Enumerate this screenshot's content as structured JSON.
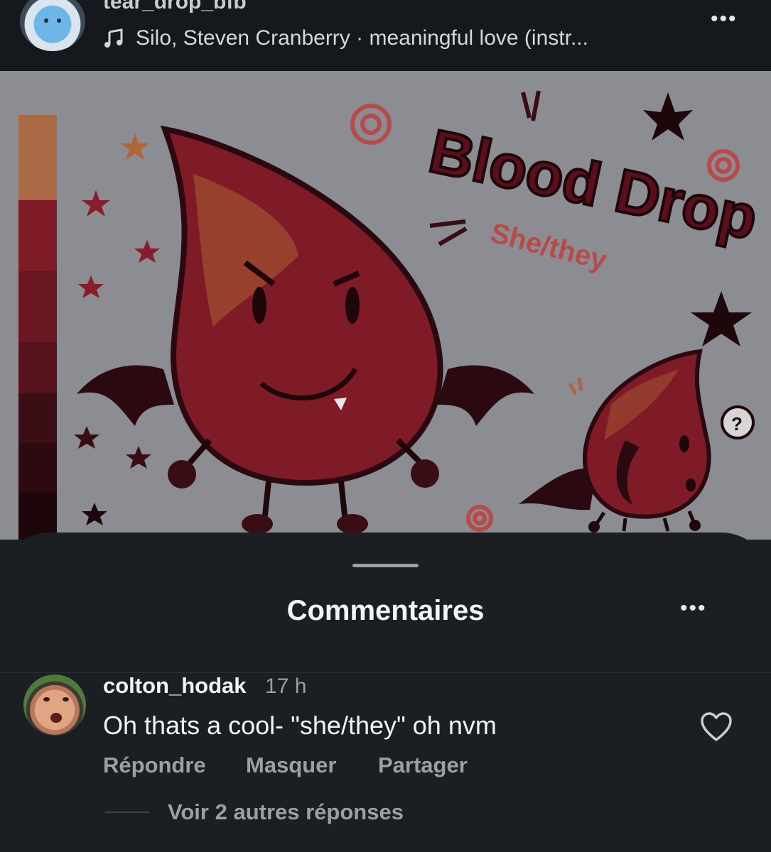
{
  "post": {
    "username": "tear_drop_bfb",
    "music": "Silo, Steven Cranberry · meaningful love (instr...",
    "more_icon": "more-horizontal-icon",
    "image": {
      "title": "Blood Drop",
      "pronouns": "She/they",
      "palette": [
        "#b0653a",
        "#8a1d2b",
        "#6e1623",
        "#4f101b",
        "#3a0c14",
        "#2a0a10",
        "#1d070b"
      ]
    }
  },
  "comments": {
    "title": "Commentaires",
    "items": [
      {
        "user": "colton_hodak",
        "time": "17 h",
        "text": "Oh thats a cool- \"she/they\" oh nvm",
        "actions": {
          "reply": "Répondre",
          "hide": "Masquer",
          "share": "Partager"
        },
        "replies_label": "Voir 2 autres réponses"
      }
    ]
  }
}
